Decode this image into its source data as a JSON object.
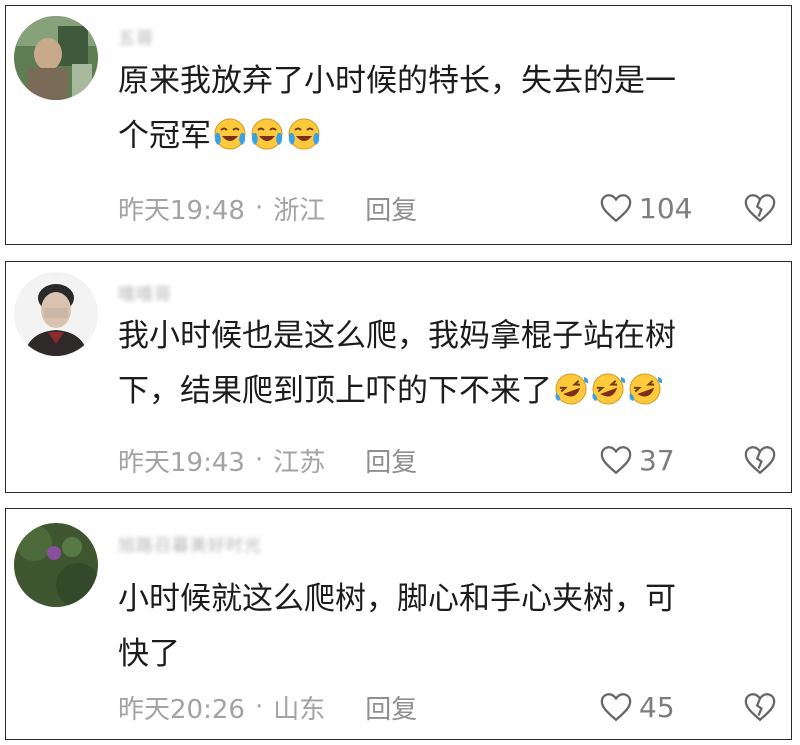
{
  "comments": [
    {
      "username": "五哥",
      "text_line1": "原来我放弃了小时候的特长，失去的是一",
      "text_line2": "个冠军",
      "emoji": [
        "crying-laugh-emoji",
        "crying-laugh-emoji",
        "crying-laugh-emoji"
      ],
      "time": "昨天19:48",
      "separator": "·",
      "location": "浙江",
      "reply_label": "回复",
      "like_count": "104"
    },
    {
      "username": "嘻嘻哥",
      "text_line1": "我小时候也是这么爬，我妈拿棍子站在树",
      "text_line2": "下，结果爬到顶上吓的下不来了",
      "emoji": [
        "rofl-emoji",
        "rofl-emoji",
        "rofl-emoji"
      ],
      "time": "昨天19:43",
      "separator": "·",
      "location": "江苏",
      "reply_label": "回复",
      "like_count": "37"
    },
    {
      "username": "旭路召暮美好时光",
      "text_line1": "小时候就这么爬树，脚心和手心夹树，可",
      "text_line2": "快了",
      "emoji": [],
      "time": "昨天20:26",
      "separator": "·",
      "location": "山东",
      "reply_label": "回复",
      "like_count": "45"
    }
  ],
  "colors": {
    "border": "#2b2b2b",
    "text": "#1c1c1c",
    "meta": "#a3a3a3",
    "emoji_face": "#ffc93c",
    "emoji_tear": "#3aa0e8"
  },
  "icons": {
    "like": "heart-outline-icon",
    "dislike": "broken-heart-icon"
  }
}
